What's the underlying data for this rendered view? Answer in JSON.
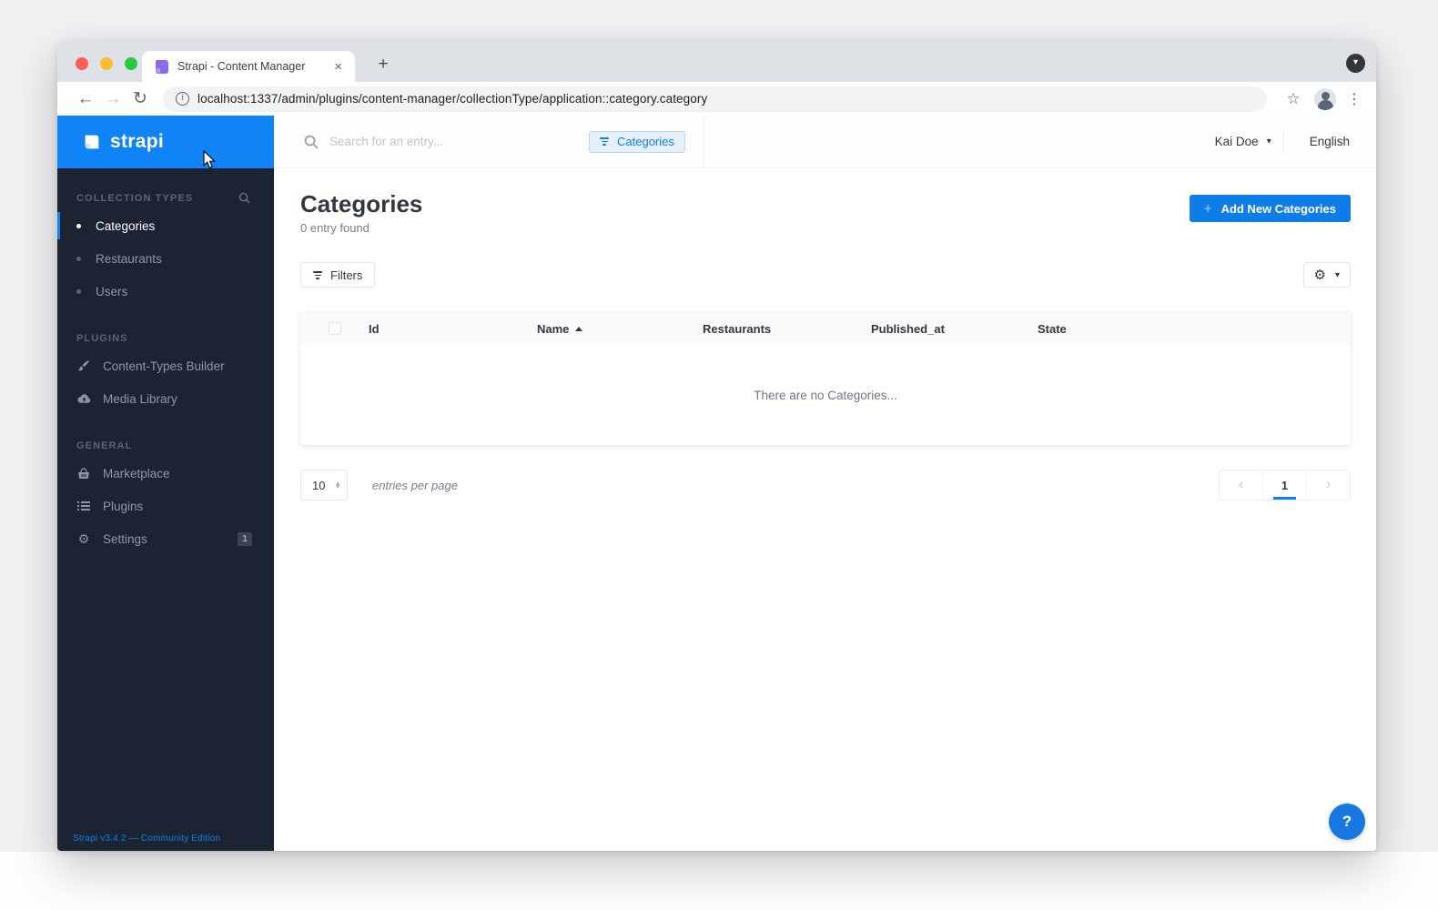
{
  "colors": {
    "primary": "#0e7de7",
    "brand_header": "#1083f7",
    "sidebar_bg": "#1c2433",
    "chip_bg": "#e6f0fd"
  },
  "browser": {
    "tab_title": "Strapi - Content Manager",
    "url": "localhost:1337/admin/plugins/content-manager/collectionType/application::category.category"
  },
  "icons": {
    "caret_down": "▾",
    "close": "×",
    "new_tab": "+",
    "back_arrow": "←",
    "forward_arrow": "→",
    "reload": "↻",
    "info": "i",
    "star": "☆",
    "menu_dots": "⋮",
    "gear": "⚙",
    "plus": "+",
    "chevron_left": "‹",
    "chevron_right": "›",
    "stepper_up": "▴",
    "stepper_down": "▾"
  },
  "sidebar": {
    "brand": "strapi",
    "sections": [
      {
        "label": "COLLECTION TYPES",
        "items": [
          {
            "label": "Categories"
          },
          {
            "label": "Restaurants"
          },
          {
            "label": "Users"
          }
        ]
      },
      {
        "label": "PLUGINS",
        "items": [
          {
            "label": "Content-Types Builder"
          },
          {
            "label": "Media Library"
          }
        ]
      },
      {
        "label": "GENERAL",
        "items": [
          {
            "label": "Marketplace"
          },
          {
            "label": "Plugins"
          },
          {
            "label": "Settings",
            "badge": "1"
          }
        ]
      }
    ],
    "footer": "Strapi v3.4.2 — Community Edition"
  },
  "topbar": {
    "search_placeholder": "Search for an entry...",
    "filter_chip": "Categories",
    "user_name": "Kai Doe",
    "language": "English"
  },
  "main": {
    "title": "Categories",
    "subtitle": "0 entry found",
    "add_button": "Add New Categories",
    "filters_button": "Filters",
    "table": {
      "columns": [
        "Id",
        "Name",
        "Restaurants",
        "Published_at",
        "State"
      ],
      "sorted_column": "Name",
      "sort_direction": "asc",
      "empty_message": "There are no Categories...",
      "rows": []
    },
    "pagination": {
      "entries_per_page_value": "10",
      "entries_per_page_label": "entries per page",
      "current_page": "1"
    },
    "help_label": "?"
  }
}
